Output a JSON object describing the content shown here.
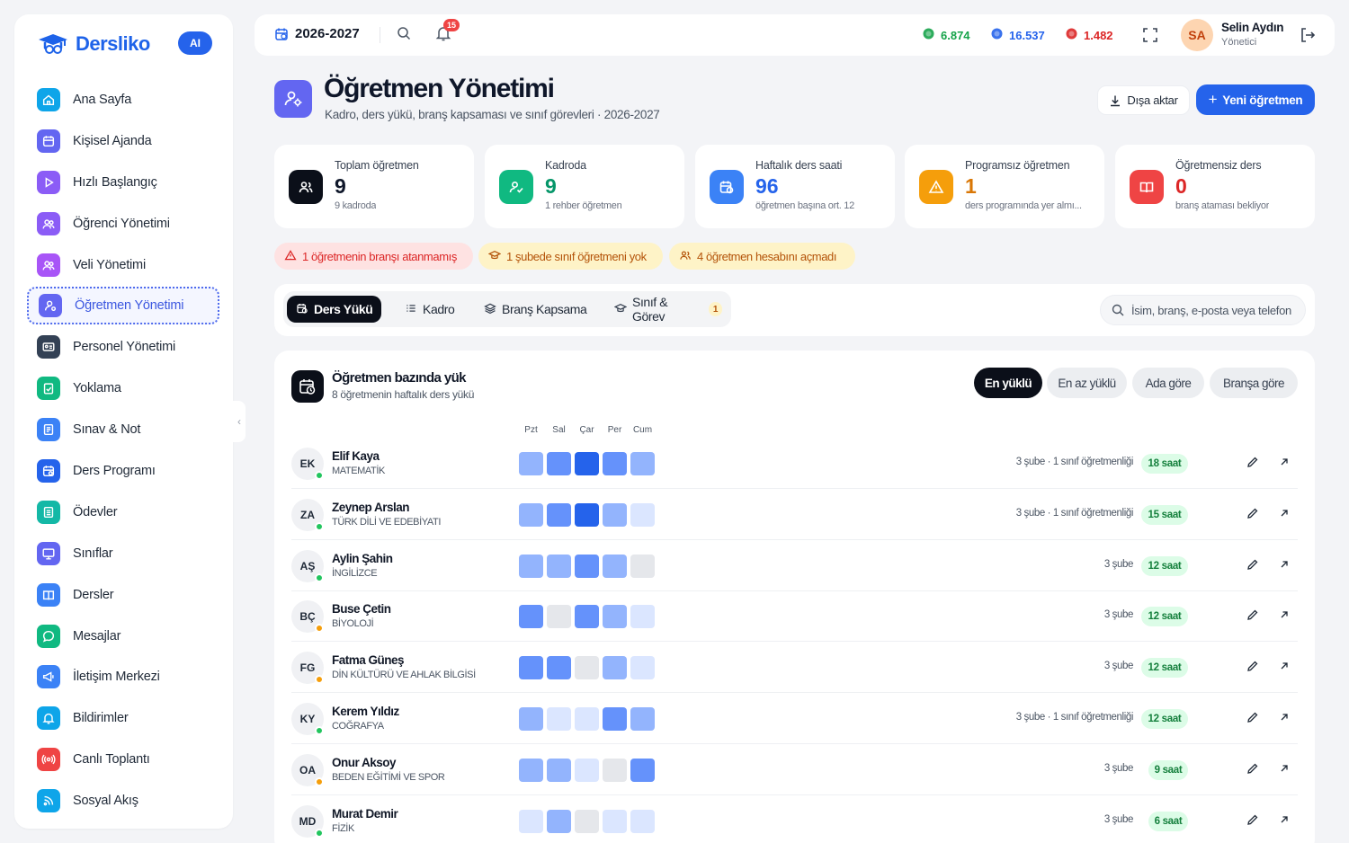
{
  "brand": {
    "name": "Dersliko",
    "ai": "AI"
  },
  "sidebar": {
    "items": [
      {
        "label": "Ana Sayfa",
        "icon": "home-icon",
        "color": "#0ea5e9"
      },
      {
        "label": "Kişisel Ajanda",
        "icon": "calendar-icon",
        "color": "#6366f1"
      },
      {
        "label": "Hızlı Başlangıç",
        "icon": "play-icon",
        "color": "#8b5cf6"
      },
      {
        "label": "Öğrenci Yönetimi",
        "icon": "students-icon",
        "color": "#8b5cf6"
      },
      {
        "label": "Veli Yönetimi",
        "icon": "parents-icon",
        "color": "#a855f7"
      },
      {
        "label": "Öğretmen Yönetimi",
        "icon": "teacher-icon",
        "color": "#6366f1"
      },
      {
        "label": "Personel Yönetimi",
        "icon": "id-card-icon",
        "color": "#334155"
      },
      {
        "label": "Yoklama",
        "icon": "clipboard-check-icon",
        "color": "#10b981"
      },
      {
        "label": "Sınav & Not",
        "icon": "exam-icon",
        "color": "#3b82f6"
      },
      {
        "label": "Ders Programı",
        "icon": "schedule-icon",
        "color": "#2563eb"
      },
      {
        "label": "Ödevler",
        "icon": "homework-icon",
        "color": "#14b8a6"
      },
      {
        "label": "Sınıflar",
        "icon": "classroom-icon",
        "color": "#6366f1"
      },
      {
        "label": "Dersler",
        "icon": "book-icon",
        "color": "#3b82f6"
      },
      {
        "label": "Mesajlar",
        "icon": "chat-icon",
        "color": "#10b981"
      },
      {
        "label": "İletişim Merkezi",
        "icon": "megaphone-icon",
        "color": "#3b82f6"
      },
      {
        "label": "Bildirimler",
        "icon": "bell-icon",
        "color": "#0ea5e9"
      },
      {
        "label": "Canlı Toplantı",
        "icon": "broadcast-icon",
        "color": "#ef4444"
      },
      {
        "label": "Sosyal Akış",
        "icon": "rss-icon",
        "color": "#0ea5e9"
      }
    ]
  },
  "topbar": {
    "year": "2026-2027",
    "notifications": "15",
    "coins": [
      {
        "value": "6.874",
        "color": "#16a34a",
        "icon": "green-coin-icon"
      },
      {
        "value": "16.537",
        "color": "#2563eb",
        "icon": "blue-gem-icon"
      },
      {
        "value": "1.482",
        "color": "#dc2626",
        "icon": "red-fire-icon"
      }
    ],
    "user": {
      "initials": "SA",
      "name": "Selin Aydın",
      "role": "Yönetici"
    }
  },
  "header": {
    "title": "Öğretmen Yönetimi",
    "subtitle": "Kadro, ders yükü, branş kapsaması ve sınıf görevleri · 2026-2027",
    "export": "Dışa aktar",
    "new": "Yeni öğretmen"
  },
  "stats": [
    {
      "label": "Toplam öğretmen",
      "value": "9",
      "sub": "9 kadroda",
      "color": "#0b0f19",
      "valueColor": "#0f172a",
      "icon": "users-icon"
    },
    {
      "label": "Kadroda",
      "value": "9",
      "sub": "1 rehber öğretmen",
      "color": "#10b981",
      "valueColor": "#059669",
      "icon": "user-check-icon"
    },
    {
      "label": "Haftalık ders saati",
      "value": "96",
      "sub": "öğretmen başına ort. 12",
      "color": "#3b82f6",
      "valueColor": "#2563eb",
      "icon": "calendar-clock-icon"
    },
    {
      "label": "Programsız öğretmen",
      "value": "1",
      "sub": "ders programında yer almı...",
      "color": "#f59e0b",
      "valueColor": "#d97706",
      "icon": "warning-icon"
    },
    {
      "label": "Öğretmensiz ders",
      "value": "0",
      "sub": "branş ataması bekliyor",
      "color": "#ef4444",
      "valueColor": "#dc2626",
      "icon": "book-open-icon"
    }
  ],
  "alerts": [
    {
      "text": "1 öğretmenin branşı atanmamış",
      "bg": "#fee2e2",
      "fg": "#dc2626",
      "icon": "warning-icon"
    },
    {
      "text": "1 şubede sınıf öğretmeni yok",
      "bg": "#fef3c7",
      "fg": "#b45309",
      "icon": "mortarboard-icon"
    },
    {
      "text": "4 öğretmen hesabını açmadı",
      "bg": "#fef3c7",
      "fg": "#b45309",
      "icon": "users-icon"
    }
  ],
  "tabs": [
    {
      "label": "Ders Yükü",
      "icon": "calendar-clock-icon"
    },
    {
      "label": "Kadro",
      "icon": "list-icon"
    },
    {
      "label": "Branş Kapsama",
      "icon": "layers-icon"
    },
    {
      "label": "Sınıf & Görev",
      "icon": "mortarboard-icon",
      "count": "1"
    }
  ],
  "search": {
    "placeholder": "İsim, branş, e-posta veya telefon"
  },
  "load": {
    "title": "Öğretmen bazında yük",
    "subtitle": "8 öğretmenin haftalık ders yükü",
    "sorts": [
      "En yüklü",
      "En az yüklü",
      "Ada göre",
      "Branşa göre"
    ],
    "days": [
      "Pzt",
      "Sal",
      "Çar",
      "Per",
      "Cum"
    ],
    "teachers": [
      {
        "initials": "EK",
        "name": "Elif Kaya",
        "branch": "MATEMATİK",
        "status": "#22c55e",
        "levels": [
          2,
          3,
          4,
          3,
          2
        ],
        "meta": "3 şube · 1 sınıf öğretmenliği",
        "hours": "18 saat"
      },
      {
        "initials": "ZA",
        "name": "Zeynep Arslan",
        "branch": "TÜRK DİLİ VE EDEBİYATI",
        "status": "#22c55e",
        "levels": [
          2,
          3,
          4,
          2,
          1
        ],
        "meta": "3 şube · 1 sınıf öğretmenliği",
        "hours": "15 saat"
      },
      {
        "initials": "AŞ",
        "name": "Aylin Şahin",
        "branch": "İNGİLİZCE",
        "status": "#22c55e",
        "levels": [
          2,
          2,
          3,
          2,
          0
        ],
        "meta": "3 şube",
        "hours": "12 saat"
      },
      {
        "initials": "BÇ",
        "name": "Buse Çetin",
        "branch": "BİYOLOJİ",
        "status": "#f59e0b",
        "levels": [
          3,
          0,
          3,
          2,
          1
        ],
        "meta": "3 şube",
        "hours": "12 saat"
      },
      {
        "initials": "FG",
        "name": "Fatma Güneş",
        "branch": "DİN KÜLTÜRÜ VE AHLAK BİLGİSİ",
        "status": "#f59e0b",
        "levels": [
          3,
          3,
          0,
          2,
          1
        ],
        "meta": "3 şube",
        "hours": "12 saat"
      },
      {
        "initials": "KY",
        "name": "Kerem Yıldız",
        "branch": "COĞRAFYA",
        "status": "#22c55e",
        "levels": [
          2,
          1,
          1,
          3,
          2
        ],
        "meta": "3 şube · 1 sınıf öğretmenliği",
        "hours": "12 saat"
      },
      {
        "initials": "OA",
        "name": "Onur Aksoy",
        "branch": "BEDEN EĞİTİMİ VE SPOR",
        "status": "#f59e0b",
        "levels": [
          2,
          2,
          1,
          0,
          3
        ],
        "meta": "3 şube",
        "hours": "9 saat"
      },
      {
        "initials": "MD",
        "name": "Murat Demir",
        "branch": "FİZİK",
        "status": "#22c55e",
        "levels": [
          1,
          2,
          0,
          1,
          1
        ],
        "meta": "3 şube",
        "hours": "6 saat"
      }
    ]
  }
}
